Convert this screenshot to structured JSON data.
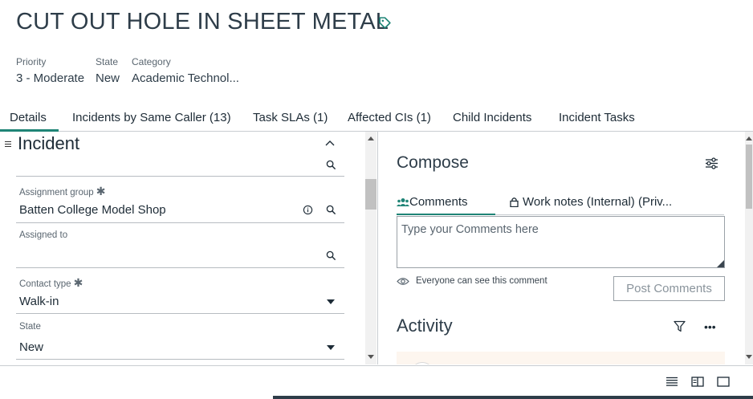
{
  "record": {
    "title": "CUT OUT HOLE IN SHEET METAL"
  },
  "meta": {
    "priority_label": "Priority",
    "priority_value": "3 - Moderate",
    "state_label": "State",
    "state_value": "New",
    "category_label": "Category",
    "category_value": "Academic Technol..."
  },
  "tabs": [
    {
      "label": "Details"
    },
    {
      "label": "Incidents by Same Caller (13)"
    },
    {
      "label": "Task SLAs (1)"
    },
    {
      "label": "Affected CIs (1)"
    },
    {
      "label": "Child Incidents"
    },
    {
      "label": "Incident Tasks"
    }
  ],
  "form": {
    "section_title": "Incident",
    "fields": {
      "assignment_group_label": "Assignment group",
      "assignment_group_value": "Batten College Model Shop",
      "assigned_to_label": "Assigned to",
      "assigned_to_value": "",
      "contact_type_label": "Contact type",
      "contact_type_value": "Walk-in",
      "state_label": "State",
      "state_value": "New",
      "required_mark": "✱"
    }
  },
  "compose": {
    "title": "Compose",
    "tab_comments": "Comments",
    "tab_work_notes": "Work notes (Internal) (Priv...",
    "placeholder": "Type your Comments here",
    "visibility_note": "Everyone can see this comment",
    "post_button": "Post Comments"
  },
  "activity": {
    "title": "Activity",
    "more": "•••"
  },
  "colors": {
    "accent": "#1f8476",
    "text": "#1d2b36",
    "muted": "#5a6670",
    "border": "#c9cdd1"
  },
  "icons": [
    "tag-icon",
    "drag-handle-icon",
    "chevron-up-icon",
    "search-icon",
    "info-icon",
    "caret-down-icon",
    "settings-sliders-icon",
    "users-icon",
    "lock-icon",
    "eye-icon",
    "filter-icon",
    "more-icon",
    "list-view-icon",
    "split-view-icon",
    "single-view-icon"
  ]
}
